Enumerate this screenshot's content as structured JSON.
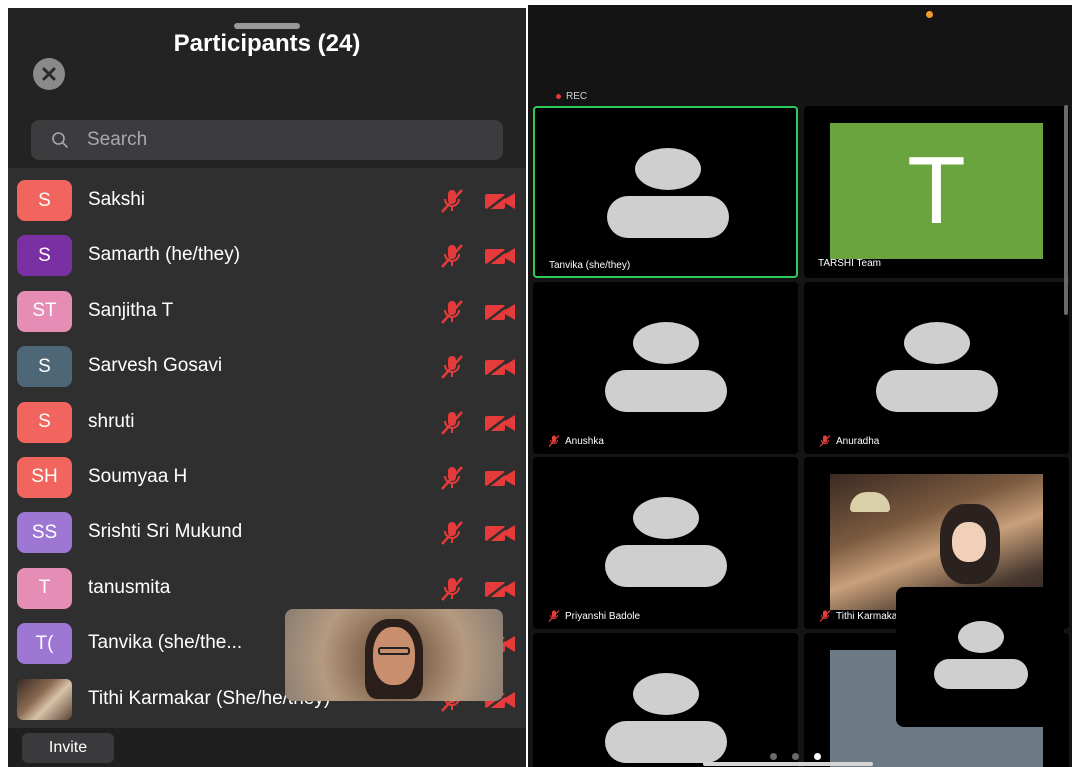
{
  "participants_panel": {
    "title": "Participants (24)",
    "search_placeholder": "Search",
    "invite_label": "Invite",
    "participants": [
      {
        "initials": "S",
        "name": "Sakshi",
        "color": "#f2645e"
      },
      {
        "initials": "S",
        "name": "Samarth (he/they)",
        "color": "#7a2fa3"
      },
      {
        "initials": "ST",
        "name": "Sanjitha T",
        "color": "#e58db4"
      },
      {
        "initials": "S",
        "name": "Sarvesh Gosavi",
        "color": "#4e6777"
      },
      {
        "initials": "S",
        "name": "shruti",
        "color": "#f2645e"
      },
      {
        "initials": "SH",
        "name": "Soumyaa H",
        "color": "#f2645e"
      },
      {
        "initials": "SS",
        "name": "Srishti Sri Mukund",
        "color": "#9e77d4"
      },
      {
        "initials": "T",
        "name": "tanusmita",
        "color": "#e58db4"
      },
      {
        "initials": "T(",
        "name": "Tanvika (she/the...",
        "color": "#9e77d4"
      },
      {
        "initials": "",
        "name": "Tithi Karmakar (She/he/they)",
        "color": ""
      }
    ]
  },
  "meeting_view": {
    "rec_label": "REC",
    "tiles": [
      {
        "name": "Tanvika (she/they)",
        "muted": false
      },
      {
        "name": "TARSHI Team",
        "avatar_letter": "T",
        "muted": false
      },
      {
        "name": "Anushka",
        "muted": true
      },
      {
        "name": "Anuradha",
        "muted": true
      },
      {
        "name": "Priyanshi Badole",
        "muted": true
      },
      {
        "name": "Tithi Karmakar",
        "muted": true
      }
    ]
  },
  "colors": {
    "accent_green": "#2fc95a",
    "mute_red": "#e53b3b",
    "recording_dot": "#e03a3a",
    "status_orange": "#f29a2e"
  }
}
